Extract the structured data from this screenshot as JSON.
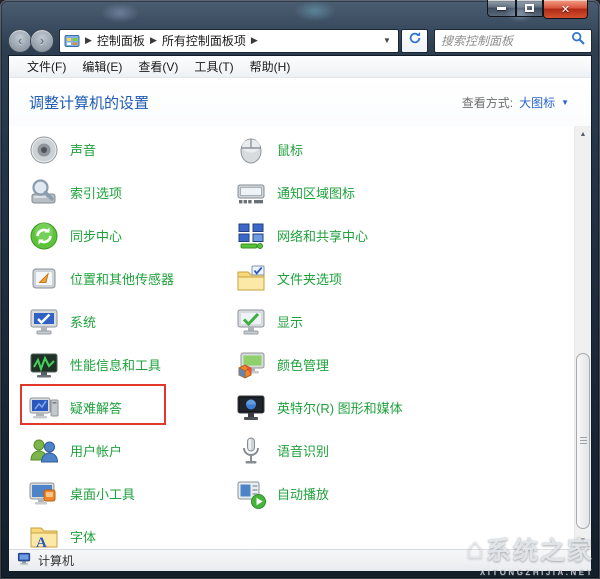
{
  "window": {
    "controls": {
      "minimize": "minimize",
      "maximize": "maximize",
      "close": "close"
    }
  },
  "nav": {
    "breadcrumb": [
      "控制面板",
      "所有控制面板项"
    ],
    "search_placeholder": "搜索控制面板"
  },
  "menu": {
    "items": [
      "文件(F)",
      "编辑(E)",
      "查看(V)",
      "工具(T)",
      "帮助(H)"
    ]
  },
  "header": {
    "title": "调整计算机的设置",
    "view_by_label": "查看方式:",
    "view_by_value": "大图标"
  },
  "items": {
    "left": [
      {
        "id": "sound",
        "label": "声音",
        "icon": "sound-icon"
      },
      {
        "id": "indexing-options",
        "label": "索引选项",
        "icon": "indexing-options-icon"
      },
      {
        "id": "sync-center",
        "label": "同步中心",
        "icon": "sync-center-icon"
      },
      {
        "id": "location-sensors",
        "label": "位置和其他传感器",
        "icon": "location-sensors-icon"
      },
      {
        "id": "system",
        "label": "系统",
        "icon": "system-icon"
      },
      {
        "id": "performance-tools",
        "label": "性能信息和工具",
        "icon": "performance-tools-icon"
      },
      {
        "id": "troubleshooting",
        "label": "疑难解答",
        "icon": "troubleshooting-icon",
        "highlighted": true
      },
      {
        "id": "user-accounts",
        "label": "用户帐户",
        "icon": "user-accounts-icon"
      },
      {
        "id": "desktop-gadgets",
        "label": "桌面小工具",
        "icon": "desktop-gadgets-icon"
      },
      {
        "id": "fonts",
        "label": "字体",
        "icon": "fonts-icon"
      }
    ],
    "right": [
      {
        "id": "mouse",
        "label": "鼠标",
        "icon": "mouse-icon"
      },
      {
        "id": "notification-area",
        "label": "通知区域图标",
        "icon": "notification-area-icon"
      },
      {
        "id": "network-sharing",
        "label": "网络和共享中心",
        "icon": "network-sharing-icon"
      },
      {
        "id": "folder-options",
        "label": "文件夹选项",
        "icon": "folder-options-icon"
      },
      {
        "id": "display",
        "label": "显示",
        "icon": "display-icon"
      },
      {
        "id": "color-management",
        "label": "颜色管理",
        "icon": "color-management-icon"
      },
      {
        "id": "intel-graphics",
        "label": "英特尔(R) 图形和媒体",
        "icon": "intel-graphics-icon"
      },
      {
        "id": "speech-recognition",
        "label": "语音识别",
        "icon": "speech-recognition-icon"
      },
      {
        "id": "autoplay",
        "label": "自动播放",
        "icon": "autoplay-icon"
      }
    ]
  },
  "statusbar": {
    "label": "计算机"
  },
  "watermark": {
    "title": "系统之家",
    "subtitle": "XITONGZHIJIA.NET"
  },
  "colors": {
    "item_link": "#1fa13c",
    "header_title": "#1e5cb3",
    "view_link": "#2a66c9",
    "highlight_box": "#e2372c"
  }
}
